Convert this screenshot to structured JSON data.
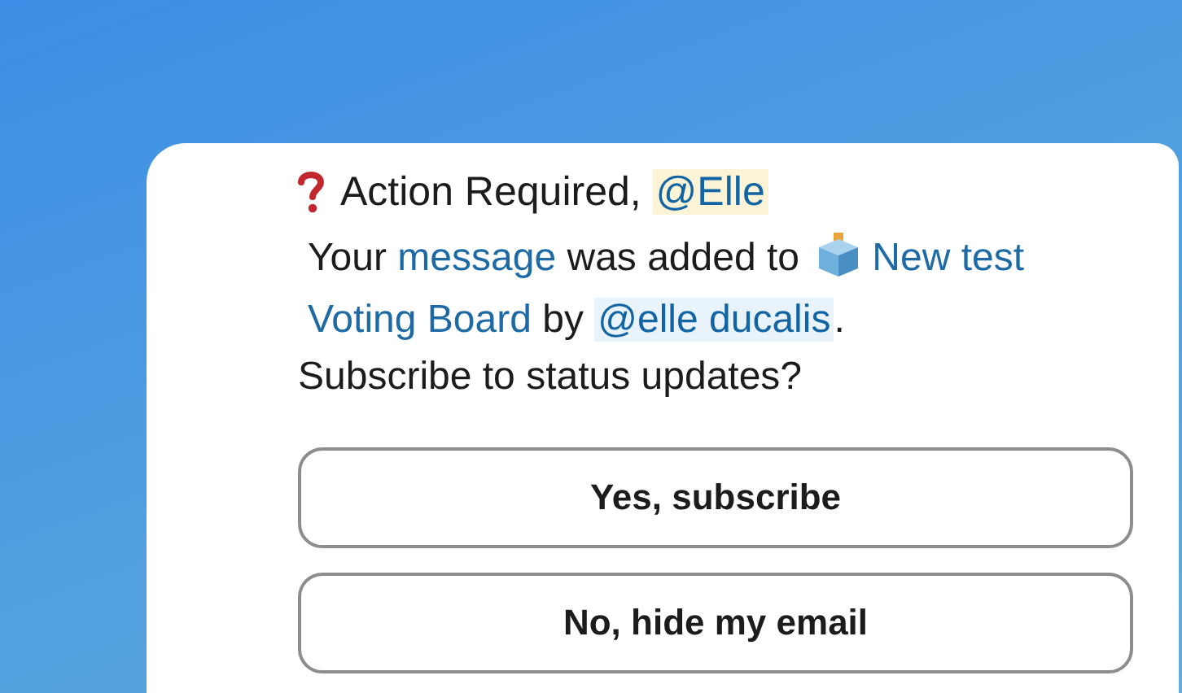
{
  "message": {
    "title": {
      "text": "Action Required, ",
      "mention": "@Elle"
    },
    "body": [
      {
        "kind": "text",
        "text": "Your "
      },
      {
        "kind": "link",
        "text": "message"
      },
      {
        "kind": "text",
        "text": " was added to "
      },
      {
        "kind": "board",
        "lines": [
          "New test",
          "Voting Board"
        ]
      },
      {
        "kind": "text",
        "text": " by "
      },
      {
        "kind": "mention",
        "text": "@elle ducalis"
      },
      {
        "kind": "text",
        "text": "."
      }
    ],
    "question": "Subscribe to status updates?"
  },
  "buttons": [
    "Yes, subscribe",
    "No, hide my email"
  ]
}
